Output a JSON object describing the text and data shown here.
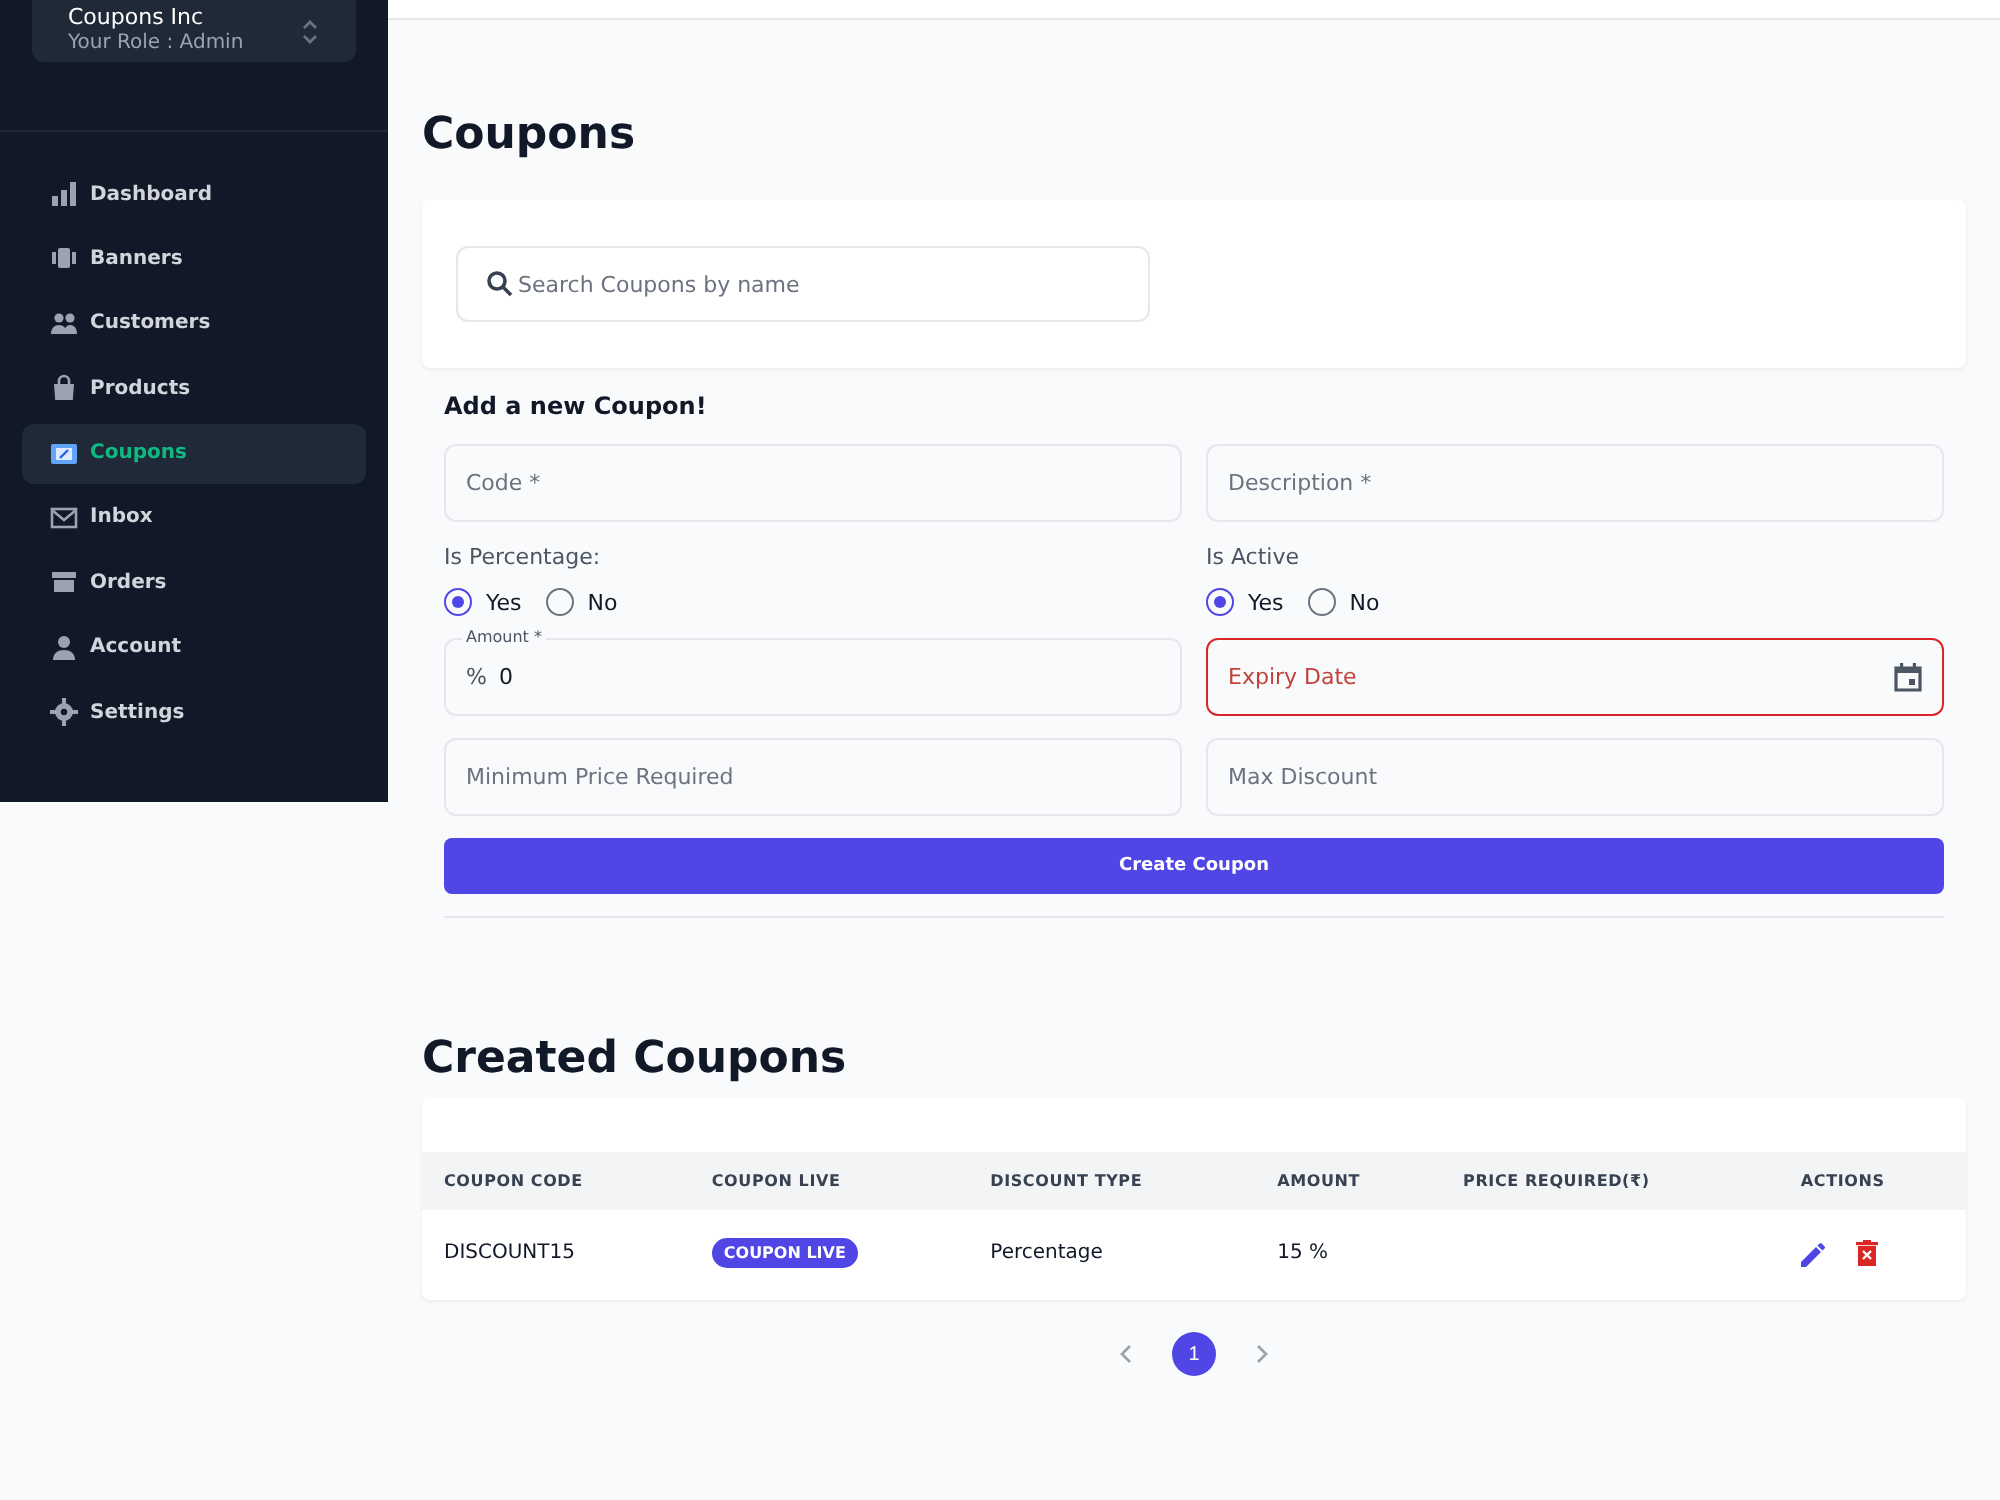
{
  "sidebar": {
    "org": {
      "name": "Coupons Inc",
      "role": "Your Role : Admin"
    },
    "items": [
      {
        "label": "Dashboard",
        "selected": false
      },
      {
        "label": "Banners",
        "selected": false
      },
      {
        "label": "Customers",
        "selected": false
      },
      {
        "label": "Products",
        "selected": false
      },
      {
        "label": "Coupons",
        "selected": true
      },
      {
        "label": "Inbox",
        "selected": false
      },
      {
        "label": "Orders",
        "selected": false
      },
      {
        "label": "Account",
        "selected": false
      },
      {
        "label": "Settings",
        "selected": false
      }
    ]
  },
  "page_title": "Coupons",
  "search": {
    "placeholder": "Search Coupons by name"
  },
  "form": {
    "title": "Add a new Coupon!",
    "fields": [
      {
        "kind": "text",
        "placeholder": "Code *"
      },
      {
        "kind": "text",
        "placeholder": "Description *"
      },
      {
        "kind": "radio",
        "label": "Is Percentage:",
        "options": [
          {
            "label": "Yes",
            "selected": true
          },
          {
            "label": "No",
            "selected": false
          }
        ]
      },
      {
        "kind": "radio",
        "label": "Is Active",
        "options": [
          {
            "label": "Yes",
            "selected": true
          },
          {
            "label": "No",
            "selected": false
          }
        ]
      },
      {
        "kind": "amount",
        "label": "Amount *",
        "prefix": "%",
        "value": "0"
      },
      {
        "kind": "date",
        "placeholder": "Expiry Date",
        "error": true
      },
      {
        "kind": "text",
        "placeholder": "Minimum Price Required"
      },
      {
        "kind": "text",
        "placeholder": "Max Discount"
      }
    ],
    "submit": "Create Coupon"
  },
  "table_title": "Created Coupons",
  "table": {
    "columns": [
      "COUPON CODE",
      "COUPON LIVE",
      "DISCOUNT TYPE",
      "AMOUNT",
      "PRICE REQUIRED(₹)",
      "ACTIONS"
    ],
    "rows": [
      {
        "code": "DISCOUNT15",
        "live": "COUPON LIVE",
        "type": "Percentage",
        "amount": "15 %"
      }
    ]
  },
  "pagination": {
    "pages": [
      {
        "label": "1",
        "selected": true
      }
    ]
  }
}
